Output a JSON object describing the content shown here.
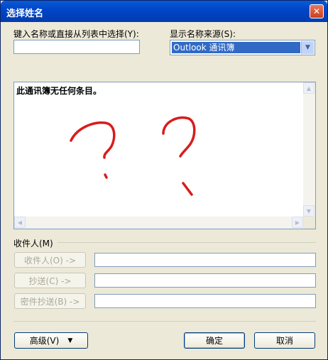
{
  "window": {
    "title": "选择姓名"
  },
  "search": {
    "label": "键入名称或直接从列表中选择(Y):",
    "value": ""
  },
  "source": {
    "label": "显示名称来源(S):",
    "selected": "Outlook 通讯簿"
  },
  "list": {
    "empty_message": "此通讯簿无任何条目。"
  },
  "recipients": {
    "group_label": "收件人(M)",
    "to_label": "收件人(O) ->",
    "cc_label": "抄送(C) ->",
    "bcc_label": "密件抄送(B) ->"
  },
  "footer": {
    "advanced_label": "高级(V)",
    "ok_label": "确定",
    "cancel_label": "取消"
  },
  "colors": {
    "titlebar": "#0046c8",
    "selection": "#316ac5",
    "annotation": "#d81c1c"
  }
}
